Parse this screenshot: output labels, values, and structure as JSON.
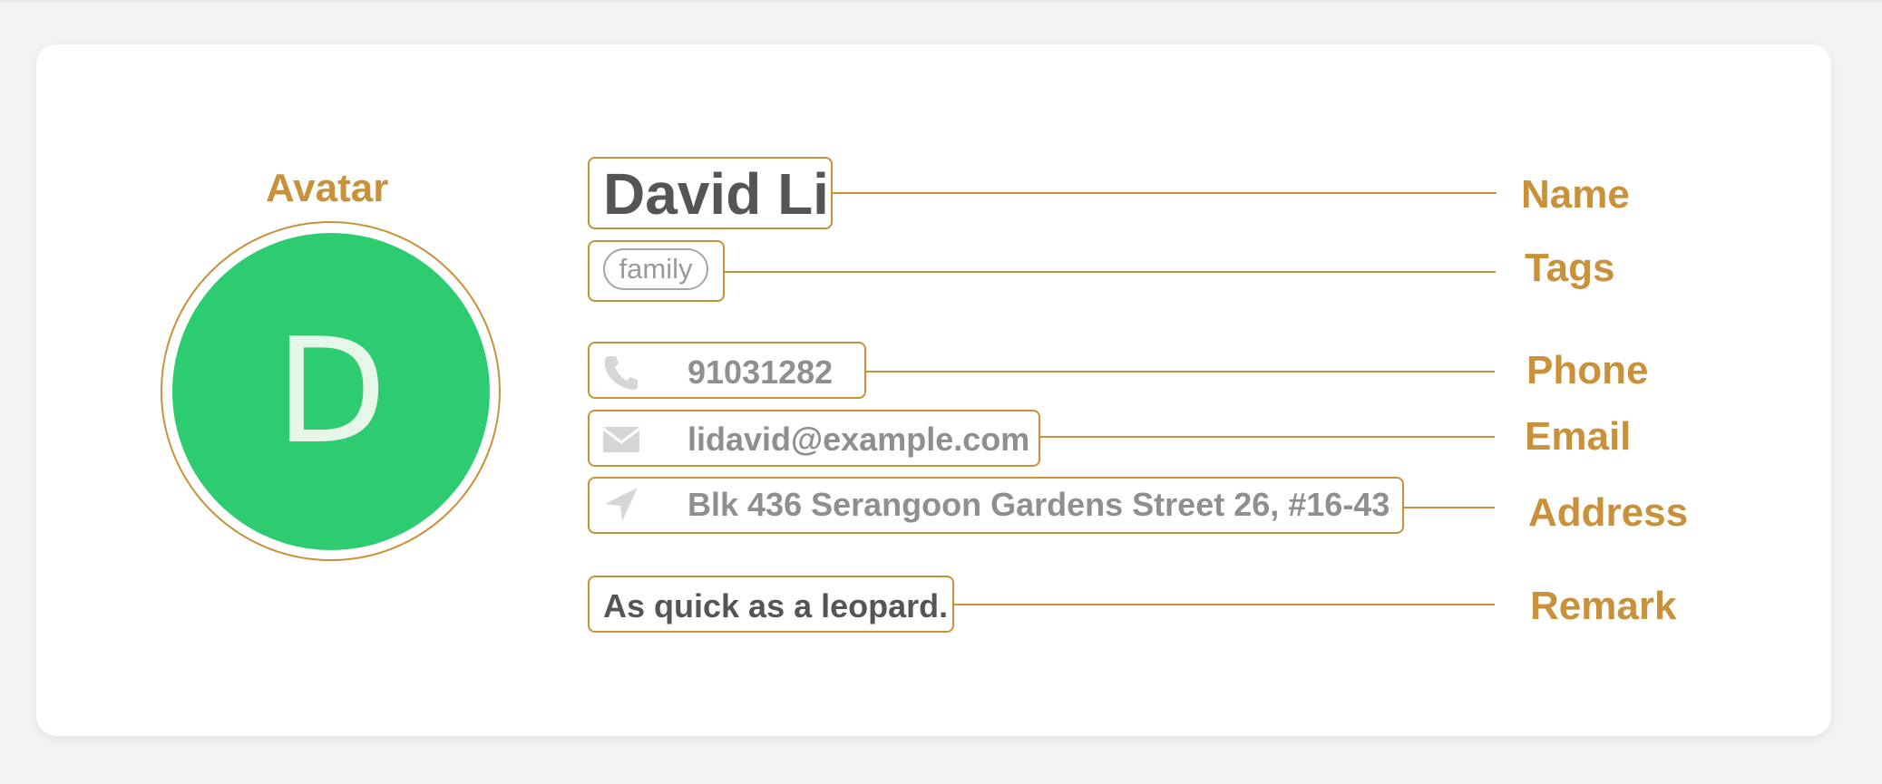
{
  "labels": {
    "avatar": "Avatar",
    "name": "Name",
    "tags": "Tags",
    "phone": "Phone",
    "email": "Email",
    "address": "Address",
    "remark": "Remark"
  },
  "person": {
    "avatar_letter": "D",
    "name": "David Li",
    "tags": [
      "family"
    ],
    "phone": "91031282",
    "email": "lidavid@example.com",
    "address": "Blk 436 Serangoon Gardens Street 26, #16-43",
    "remark": "As quick as a leopard."
  },
  "icons": {
    "phone": "phone-icon",
    "email": "envelope-icon",
    "address": "location-arrow-icon"
  },
  "colors": {
    "annotation": "#c8913a",
    "avatar_bg": "#2ecc71",
    "avatar_letter": "#e6f7ea",
    "icon": "#d6d6d6",
    "text_primary": "#555555",
    "text_secondary": "#8f8f8f"
  }
}
